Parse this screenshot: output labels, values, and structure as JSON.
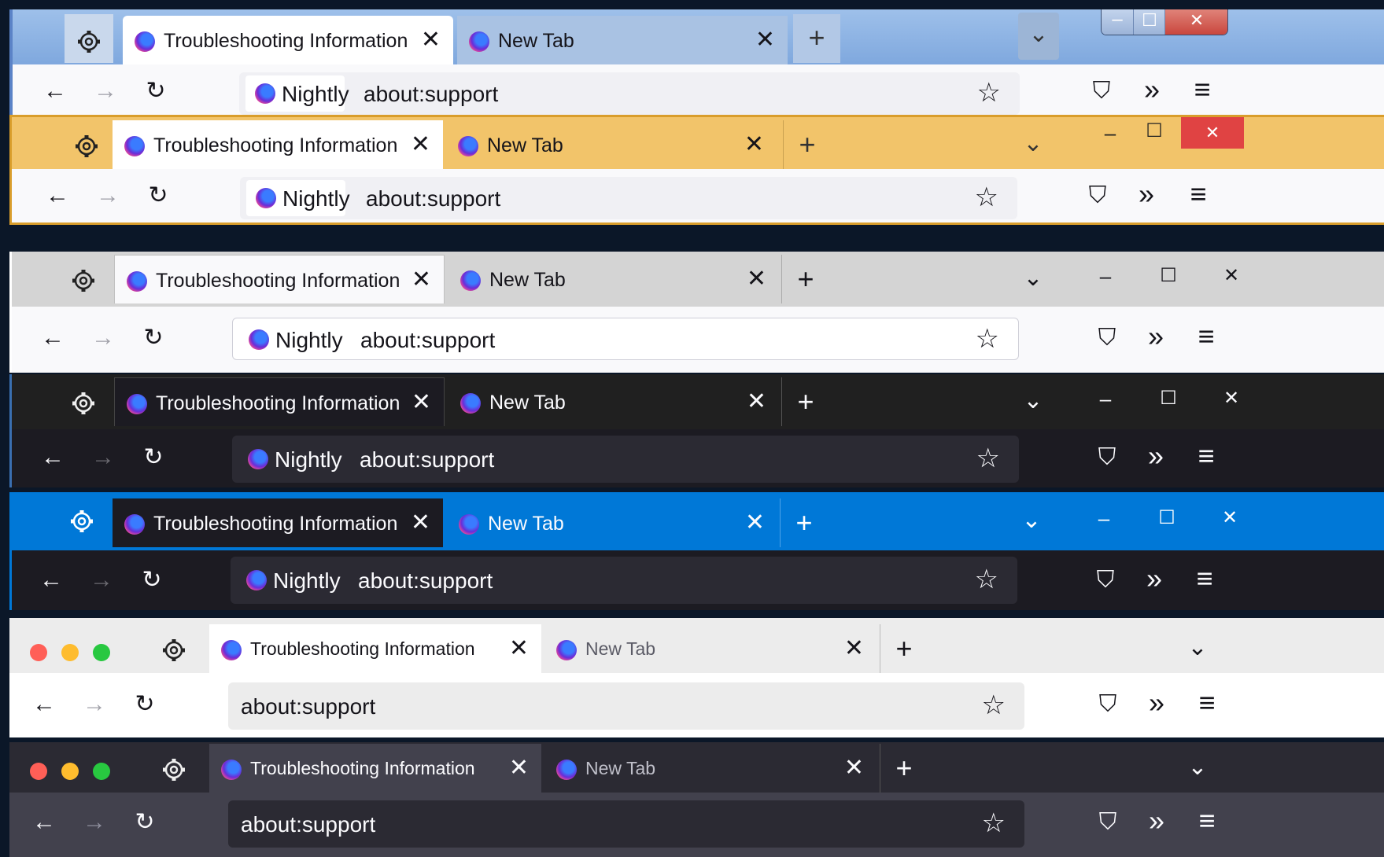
{
  "tabs": {
    "active_title": "Troubleshooting Information",
    "inactive_title": "New Tab",
    "close_glyph": "✕",
    "newtab_glyph": "+"
  },
  "urlbar": {
    "identity_label": "Nightly",
    "url": "about:support"
  },
  "icons": {
    "back": "←",
    "forward": "→",
    "reload": "↻",
    "star": "☆",
    "overflow": "»",
    "menu": "≡",
    "list_all_tabs": "⌄",
    "minimize": "–",
    "maximize": "☐",
    "close_window": "✕",
    "extensions": "⛉"
  },
  "variants": [
    {
      "name": "windows-7-aero",
      "frame": "#a9c6e8",
      "tab_bg": "#ffffff",
      "inactive_tab": "#c7d7ec",
      "toolbar": "#f9f9fb",
      "text": "#15141a",
      "url_bg": "#f0f0f4"
    },
    {
      "name": "windows-8-accent",
      "frame": "#f2c46a",
      "tab_bg": "#ffffff",
      "inactive_tab": "#f2c46a",
      "toolbar": "#f9f9fb",
      "text": "#15141a",
      "url_bg": "#f0f0f4"
    },
    {
      "name": "windows-10-light",
      "frame": "#d4d4d4",
      "tab_bg": "#f9f9fb",
      "inactive_tab": "#d4d4d4",
      "toolbar": "#f9f9fb",
      "text": "#15141a",
      "url_bg": "#ffffff"
    },
    {
      "name": "windows-10-dark",
      "frame": "#202020",
      "tab_bg": "#1c1b22",
      "inactive_tab": "#202020",
      "toolbar": "#1c1b22",
      "text": "#fbfbfe",
      "url_bg": "#2b2a33"
    },
    {
      "name": "windows-10-blue",
      "frame": "#0078d7",
      "tab_bg": "#1c1b22",
      "inactive_tab": "#0078d7",
      "toolbar": "#1c1b22",
      "text": "#fbfbfe",
      "url_bg": "#2b2a33"
    },
    {
      "name": "macos-light",
      "frame": "#ececec",
      "tab_bg": "#ffffff",
      "inactive_tab": "#ececec",
      "toolbar": "#ffffff",
      "text": "#15141a",
      "url_bg": "#ececec"
    },
    {
      "name": "macos-dark",
      "frame": "#2b2a33",
      "tab_bg": "#42414d",
      "inactive_tab": "#2b2a33",
      "toolbar": "#42414d",
      "text": "#fbfbfe",
      "url_bg": "#2b2a33"
    }
  ],
  "colors": {
    "mac_close": "#ff5f57",
    "mac_minimize": "#febc2e",
    "mac_zoom": "#28c840",
    "win7_close": "#c9463d",
    "win8_close": "#e04343"
  }
}
